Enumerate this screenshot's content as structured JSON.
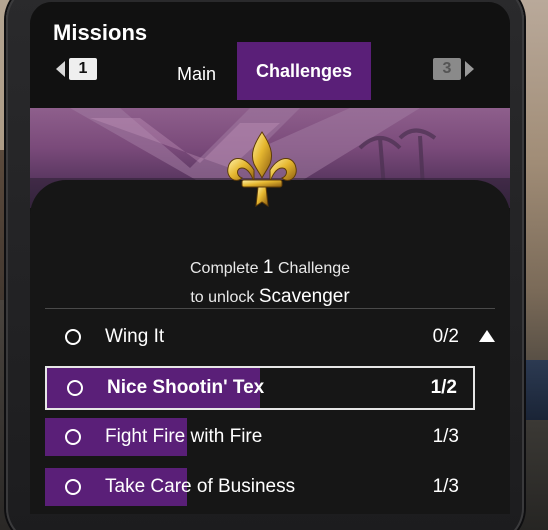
{
  "header": {
    "title": "Missions",
    "prev_key": "1",
    "next_key": "3",
    "tabs": [
      {
        "label": "Main",
        "active": false
      },
      {
        "label": "Challenges",
        "active": true
      }
    ]
  },
  "unlock": {
    "line1_pre": "Complete",
    "count": "1",
    "line1_post": "Challenge",
    "line2_pre": "to unlock",
    "reward": "Scavenger"
  },
  "challenges": [
    {
      "name": "Wing It",
      "progress": "0/2",
      "fraction": 0.0,
      "selected": false
    },
    {
      "name": "Nice Shootin' Tex",
      "progress": "1/2",
      "fraction": 0.5,
      "selected": true
    },
    {
      "name": "Fight Fire with Fire",
      "progress": "1/3",
      "fraction": 0.33,
      "selected": false
    },
    {
      "name": "Take Care of Business",
      "progress": "1/3",
      "fraction": 0.33,
      "selected": false
    }
  ],
  "colors": {
    "accent_purple": "#5a1f78",
    "emblem_gold": "#e6b830"
  },
  "icons": [
    "fleur-de-lis-icon",
    "arrow-left-icon",
    "arrow-right-icon",
    "circle-icon",
    "scroll-up-icon"
  ]
}
